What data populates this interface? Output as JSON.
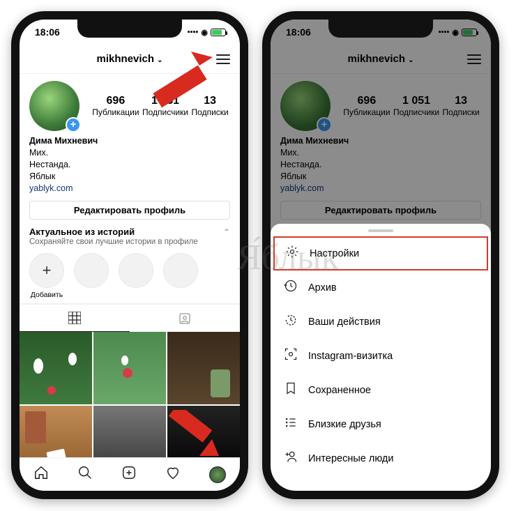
{
  "status": {
    "time": "18:06"
  },
  "header": {
    "username": "mikhnevich"
  },
  "stats": {
    "posts": {
      "value": "696",
      "label": "Публикации"
    },
    "followers": {
      "value": "1 051",
      "label": "Подписчики"
    },
    "following": {
      "value": "13",
      "label": "Подписки"
    }
  },
  "bio": {
    "name": "Дима Михневич",
    "line1": "Мих.",
    "line2": "Нестанда.",
    "line3": "Яблык",
    "link": "yablyk.com"
  },
  "edit_button": "Редактировать профиль",
  "highlights": {
    "title": "Актуальное из историй",
    "subtitle": "Сохраняйте свои лучшие истории в профиле",
    "add_label": "Добавить"
  },
  "menu": {
    "settings": "Настройки",
    "archive": "Архив",
    "activity": "Ваши действия",
    "nametag": "Instagram-визитка",
    "saved": "Сохраненное",
    "close_friends": "Близкие друзья",
    "discover": "Интересные люди"
  },
  "icons": {
    "gear": "⚙",
    "clock": "↻",
    "activity": "⟳",
    "scan": "⌂",
    "bookmark": "⃞",
    "list": "≔",
    "adduser": "+"
  }
}
